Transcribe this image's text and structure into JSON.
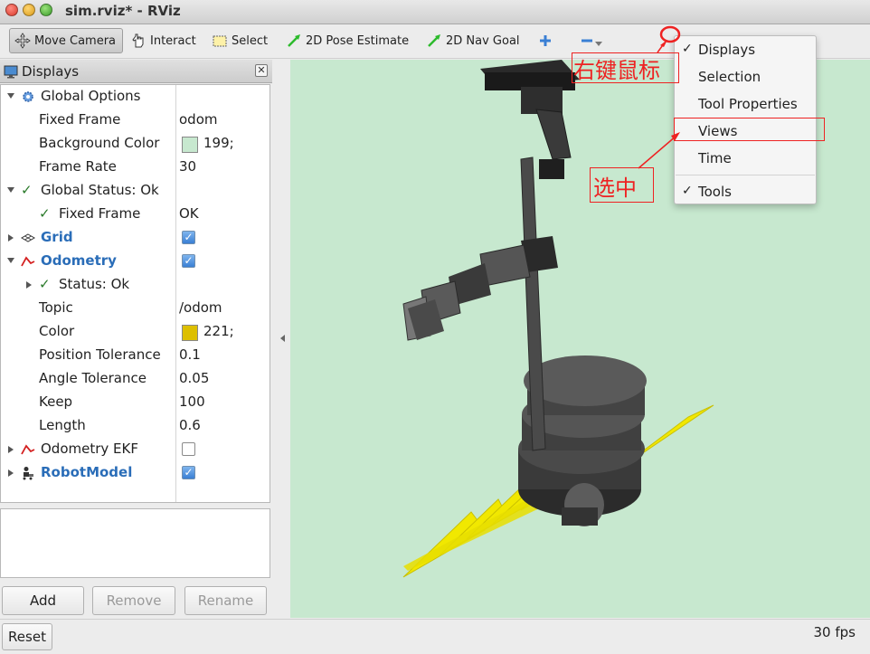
{
  "window": {
    "title": "sim.rviz* - RViz"
  },
  "toolbar": {
    "move_camera": "Move Camera",
    "interact": "Interact",
    "select": "Select",
    "pose_estimate": "2D Pose Estimate",
    "nav_goal": "2D Nav Goal"
  },
  "displays_panel": {
    "title": "Displays",
    "rows": {
      "global_options": "Global Options",
      "fixed_frame": {
        "label": "Fixed Frame",
        "value": "odom"
      },
      "background_color": {
        "label": "Background Color",
        "value": "199;",
        "color": "#c7e8cf"
      },
      "frame_rate": {
        "label": "Frame Rate",
        "value": "30"
      },
      "global_status": "Global Status: Ok",
      "gs_fixed_frame": {
        "label": "Fixed Frame",
        "value": "OK"
      },
      "grid": {
        "label": "Grid",
        "checked": true
      },
      "odometry": {
        "label": "Odometry",
        "checked": true
      },
      "status": "Status: Ok",
      "topic": {
        "label": "Topic",
        "value": "/odom"
      },
      "color": {
        "label": "Color",
        "value": "221;",
        "color": "#ddbf00"
      },
      "position_tolerance": {
        "label": "Position Tolerance",
        "value": "0.1"
      },
      "angle_tolerance": {
        "label": "Angle Tolerance",
        "value": "0.05"
      },
      "keep": {
        "label": "Keep",
        "value": "100"
      },
      "length": {
        "label": "Length",
        "value": "0.6"
      },
      "odometry_ekf": {
        "label": "Odometry EKF",
        "checked": false
      },
      "robot_model": {
        "label": "RobotModel",
        "checked": true
      }
    },
    "buttons": {
      "add": "Add",
      "remove": "Remove",
      "rename": "Rename"
    }
  },
  "context_menu": {
    "items": [
      {
        "label": "Displays",
        "checked": true
      },
      {
        "label": "Selection",
        "checked": false
      },
      {
        "label": "Tool Properties",
        "checked": false
      },
      {
        "label": "Views",
        "checked": false
      },
      {
        "label": "Time",
        "checked": false
      },
      {
        "label": "Tools",
        "checked": true
      }
    ]
  },
  "annotations": {
    "right_click": "右键鼠标",
    "select": "选中",
    "color": "#e22222"
  },
  "statusbar": {
    "reset": "Reset",
    "fps": "30 fps"
  }
}
